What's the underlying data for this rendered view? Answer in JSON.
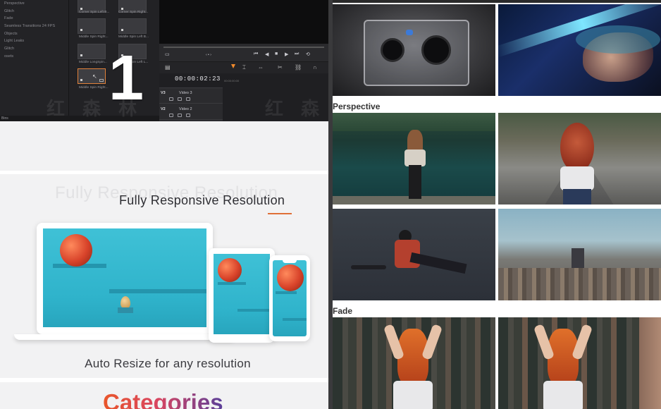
{
  "editor": {
    "effects_list": [
      "Perspective",
      "Glitch",
      "Fade",
      "Seamless Transitions 24 FPS",
      "Objects",
      "Light Leaks",
      "Glitch",
      "osets"
    ],
    "thumbnails": [
      {
        "label": "Corner Spin Left B..."
      },
      {
        "label": "Corner Spin Right..."
      },
      {
        "label": "Middle Spin Right..."
      },
      {
        "label": "Middle Spin Left B..."
      },
      {
        "label": "Middle LongSpin..."
      },
      {
        "label": "Middle Spin Left L..."
      },
      {
        "label": "Middle Spin Right..."
      }
    ],
    "bins_label": "Bins",
    "timecode": "00:00:02:23",
    "ruler_mark": "00:00:00:00",
    "tracks": [
      {
        "id": "V3",
        "name": "Video 3"
      },
      {
        "id": "V2",
        "name": "Video 2"
      }
    ],
    "overlay_number": "1",
    "watermark": "红 森 林"
  },
  "promo": {
    "ghost_title": "Fully Responsive Resolution",
    "title": "Fully Responsive Resolution",
    "caption": "Auto Resize for any resolution",
    "next_section_title": "Categories",
    "accent_color": "#e07038",
    "screen_color": "#3fc1d6"
  },
  "gallery": {
    "sections": [
      {
        "label": "Perspective"
      },
      {
        "label": "Fade"
      }
    ],
    "background": "#ffffff"
  }
}
